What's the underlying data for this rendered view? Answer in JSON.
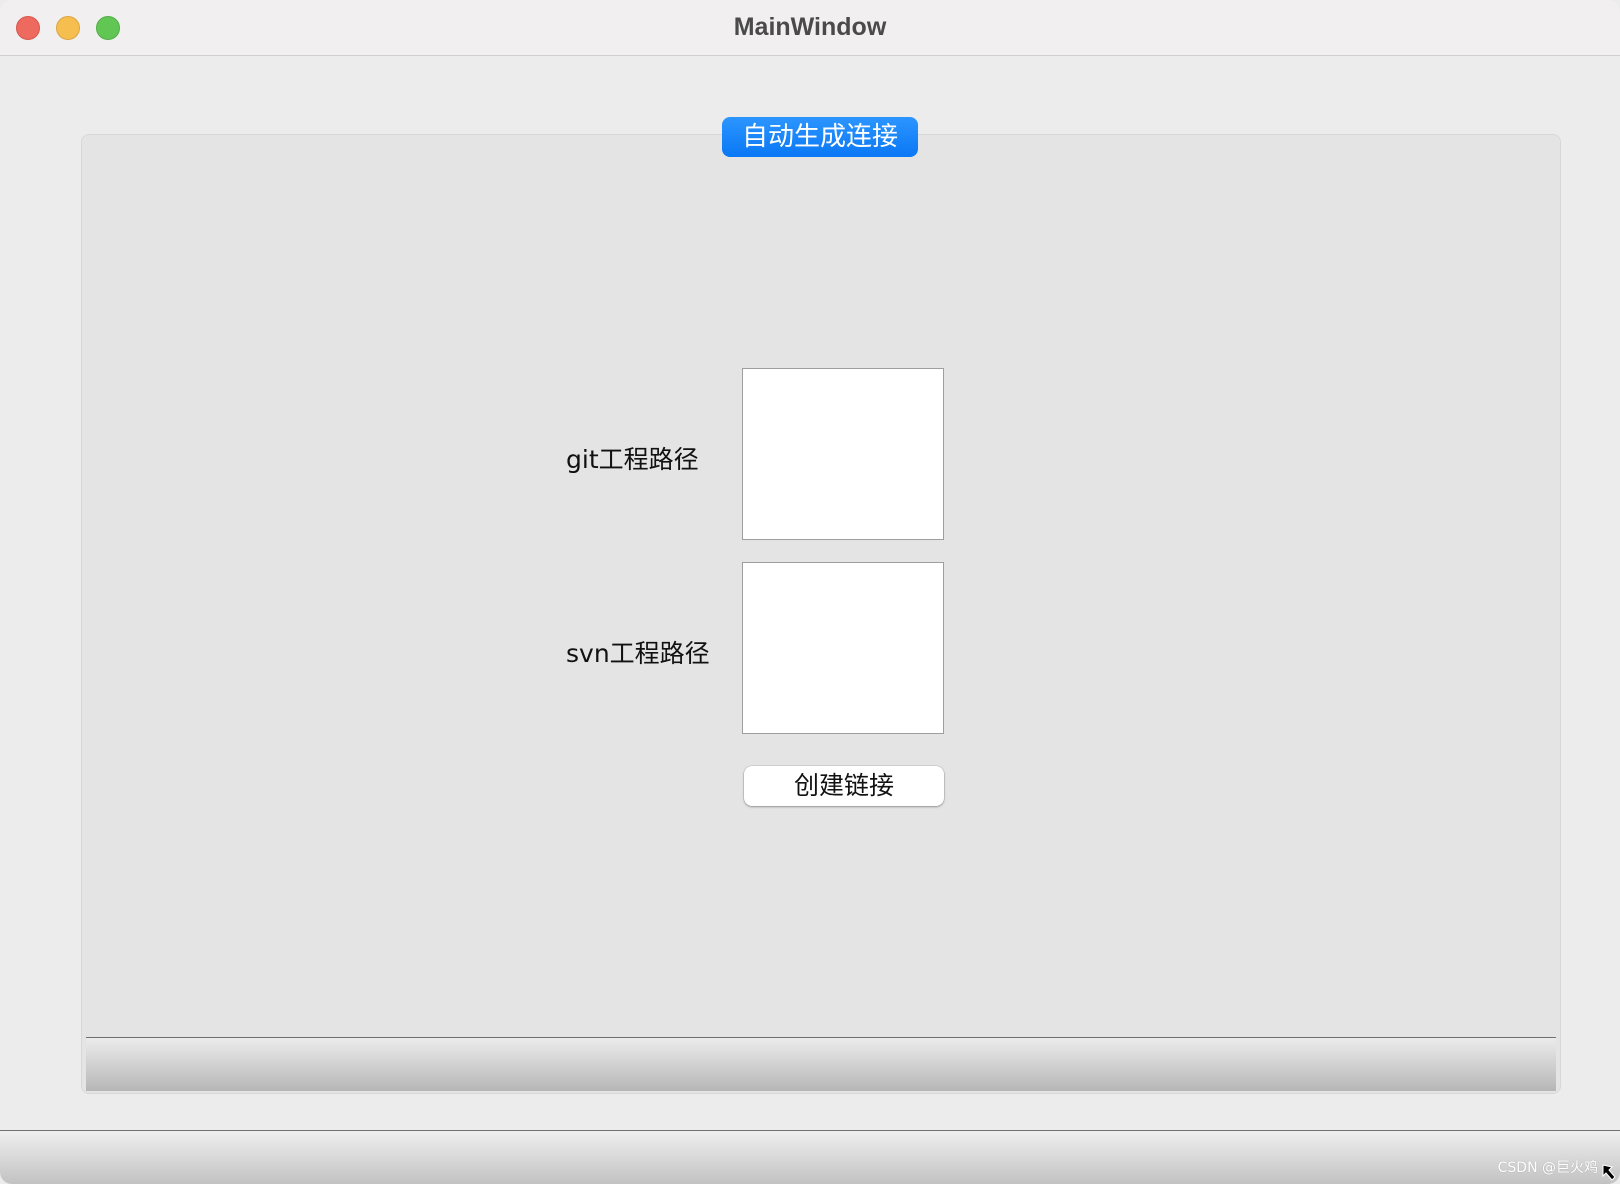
{
  "window": {
    "title": "MainWindow"
  },
  "group": {
    "title": "自动生成连接"
  },
  "form": {
    "git_label": "git工程路径",
    "svn_label": "svn工程路径",
    "git_value": "",
    "svn_value": "",
    "create_button": "创建链接"
  },
  "footer": {
    "watermark": "CSDN @巨火鸡"
  },
  "colors": {
    "accent": "#0a78f5",
    "close": "#ee6a5e",
    "minimize": "#f6be4f",
    "zoom": "#62c654"
  },
  "icons": {
    "close": "close-icon",
    "minimize": "minimize-icon",
    "zoom": "zoom-icon",
    "resize": "resize-grip-icon"
  }
}
